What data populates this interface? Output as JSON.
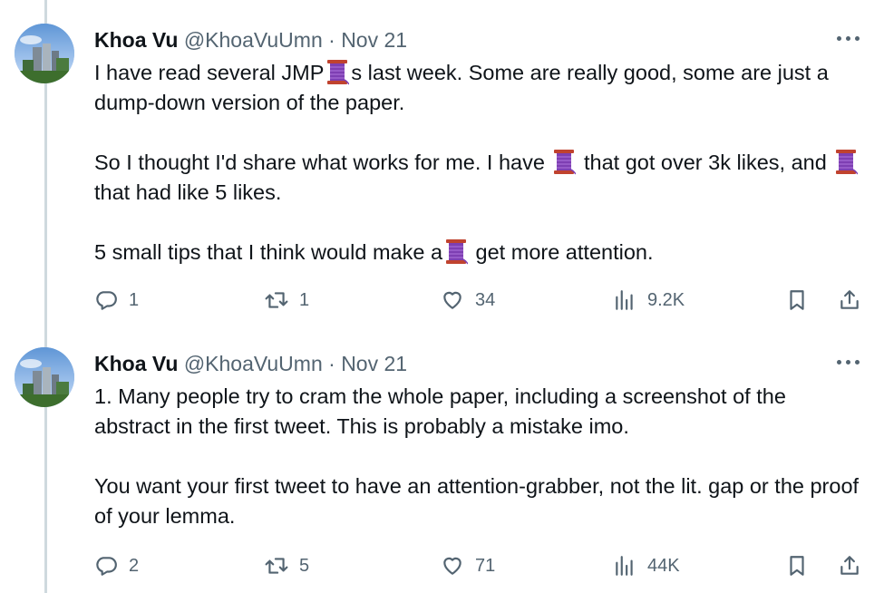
{
  "tweets": [
    {
      "author_name": "Khoa Vu",
      "handle": "@KhoaVuUmn",
      "separator": "·",
      "date": "Nov 21",
      "paragraphs": [
        [
          {
            "text": "I have read several JMP"
          },
          {
            "emoji": "spool-of-thread"
          },
          {
            "text": "s last week. Some are really good, some are just a dump-down version of the paper."
          }
        ],
        [
          {
            "text": "So I thought I'd share what works for me. I have "
          },
          {
            "emoji": "spool-of-thread"
          },
          {
            "text": " that got over 3k likes, and "
          },
          {
            "emoji": "spool-of-thread"
          },
          {
            "text": " that had like 5 likes."
          }
        ],
        [
          {
            "text": "5 small tips that I think would make a"
          },
          {
            "emoji": "spool-of-thread"
          },
          {
            "text": " get more attention."
          }
        ]
      ],
      "stats": {
        "replies": "1",
        "retweets": "1",
        "likes": "34",
        "views": "9.2K"
      }
    },
    {
      "author_name": "Khoa Vu",
      "handle": "@KhoaVuUmn",
      "separator": "·",
      "date": "Nov 21",
      "paragraphs": [
        [
          {
            "text": "1. Many people try to cram the whole paper, including a screenshot of the abstract in the first tweet. This is probably a mistake imo."
          }
        ],
        [
          {
            "text": "You want your first tweet to have an attention-grabber, not the lit. gap or the proof of your lemma."
          }
        ]
      ],
      "stats": {
        "replies": "2",
        "retweets": "5",
        "likes": "71",
        "views": "44K"
      }
    }
  ],
  "icons": {
    "reply": "reply-icon",
    "retweet": "retweet-icon",
    "like": "heart-icon",
    "views": "views-icon",
    "bookmark": "bookmark-icon",
    "share": "share-icon",
    "more": "more-icon"
  },
  "colors": {
    "text": "#0f1419",
    "secondary": "#536471",
    "thread_line": "#cfd9de",
    "spool": "#7e3fb3"
  }
}
